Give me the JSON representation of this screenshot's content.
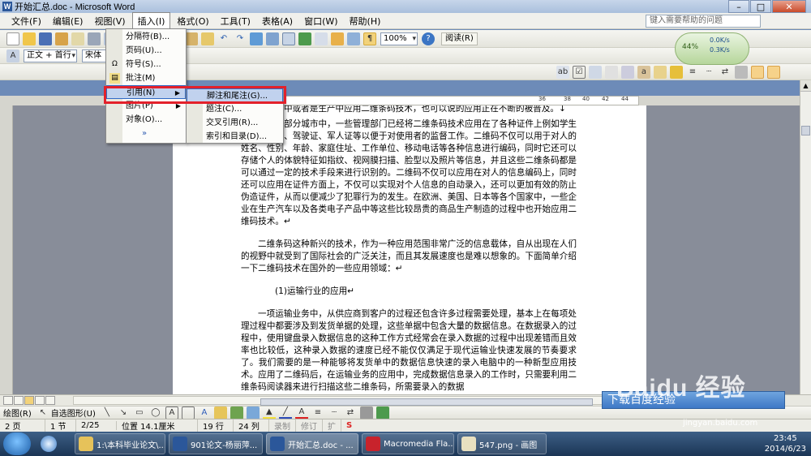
{
  "window": {
    "title": "开始汇总.doc - Microsoft Word",
    "minimize": "–",
    "maximize": "□",
    "close": "✕"
  },
  "menubar": {
    "items": [
      "文件(F)",
      "编辑(E)",
      "视图(V)",
      "插入(I)",
      "格式(O)",
      "工具(T)",
      "表格(A)",
      "窗口(W)",
      "帮助(H)"
    ],
    "help_placeholder": "键入需要帮助的问题"
  },
  "toolbar": {
    "zoom": "100%",
    "read_label": "阅读(R)",
    "style": "正文 + 首行",
    "font": "宋体"
  },
  "widget": {
    "percent": "44%",
    "net_up": "0.0K/s",
    "net_down": "0.3K/s"
  },
  "ruler": {
    "numbers": [
      "36",
      "38",
      "40",
      "42",
      "44"
    ]
  },
  "insert_menu": {
    "items": [
      {
        "label": "分隔符(B)...",
        "icon": "",
        "submenu": false
      },
      {
        "label": "页码(U)...",
        "icon": "",
        "submenu": false
      },
      {
        "label": "符号(S)...",
        "icon": "Ω",
        "submenu": false
      },
      {
        "label": "批注(M)",
        "icon": "▤",
        "submenu": false
      },
      {
        "label": "引用(N)",
        "icon": "",
        "submenu": true
      },
      {
        "label": "图片(P)",
        "icon": "",
        "submenu": true
      },
      {
        "label": "对象(O)...",
        "icon": "",
        "submenu": false
      },
      {
        "label": "»",
        "icon": "",
        "submenu": false
      }
    ]
  },
  "reference_submenu": {
    "items": [
      "脚注和尾注(G)...",
      "题注(C)...",
      "交叉引用(R)...",
      "索引和目录(D)..."
    ]
  },
  "document": {
    "paragraphs": [
      {
        "style": "plain",
        "text": "动识别设备制造协会(AIMI)与美国标协(ANSI)的符号标准。一些政府部门体已经或者正在计划在管理中或者是生产中应用二维条码技术，也可以说的应用正在不断的被普及。↓"
      },
      {
        "style": "plain",
        "text": "在美国的大部分城市中，一些管理部门已经将二维条码技术应用在了各种证件上例如学生证、身份证、驾驶证、军人证等以便于对使用者的监督工作。二维码不仅可以用于对人的姓名、性别、年龄、家庭住址、工作单位、移动电话等各种信息进行编码，同时它还可以存储个人的体貌特征如指纹、视网膜扫描、脸型以及照片等信息，并且这些二维条码都是可以通过一定的技术手段来进行识别的。二维码不仅可以应用在对人的信息编码上，同时还可以应用在证件方面上，不仅可以实现对个人信息的自动录入，还可以更加有效的防止伪造证件，从而以便减少了犯罪行为的发生。在欧洲、美国、日本等各个国家中，一些企业在生产汽车以及各类电子产品中等这些比较昂贵的商品生产制造的过程中也开始应用二维码技术。↵"
      },
      {
        "style": "ind",
        "text": "二维条码这种新兴的技术，作为一种应用范围非常广泛的信息载体，自从出现在人们的视野中就受到了国际社会的广泛关注，而且其发展速度也是难以想象的。下面简单介绍一下二维码技术在国外的一些应用领域：↵"
      },
      {
        "style": "h",
        "text": "(1)运输行业的应用↵"
      },
      {
        "style": "ind",
        "text": "一项运输业务中，从供应商到客户的过程还包含许多过程需要处理，基本上在每项处理过程中都要涉及到发货单据的处理，这些单据中包含大量的数据信息。在数据录入的过程中，使用键盘录入数据信息的这种工作方式经常会在录入数据的过程中出现差错而且效率也比较低，这种录入数据的速度已经不能仅仅满足于现代运输业快速发展的节奏要求了。我们需要的是一种能够将发货单中的数据信息快速的录入电脑中的一种新型应用技术。应用了二维码后，在运输业务的应用中，完成数据信息录入的工作时，只需要利用二维条码阅读器来进行扫描这些二维条码，所需要录入的数据"
      }
    ]
  },
  "drawbar": {
    "draw_label": "绘图(R)",
    "autoshape_label": "自选图形(U)"
  },
  "statusbar": {
    "page": "2 页",
    "section": "1 节",
    "page_of": "2/25",
    "position": "位置 14.1厘米",
    "line": "19 行",
    "column": "24 列",
    "rec": "录制",
    "trk": "修订",
    "ext": "扩"
  },
  "hint": "下载百度经验",
  "watermark": {
    "logo": "Baidu 经验",
    "url": "jingyan.baidu.com"
  },
  "taskbar": {
    "tasks": [
      "1:\\本科毕业论文\\...",
      "901论文-杨丽萍...",
      "开始汇总.doc - ...",
      "Macromedia Fla...",
      "547.png - 画图"
    ],
    "time": "23:45",
    "date": "2014/6/23"
  },
  "colors": {
    "highlight": "#c1d2ee",
    "highlight_border": "#316ac5",
    "red_box": "#e3212b"
  }
}
